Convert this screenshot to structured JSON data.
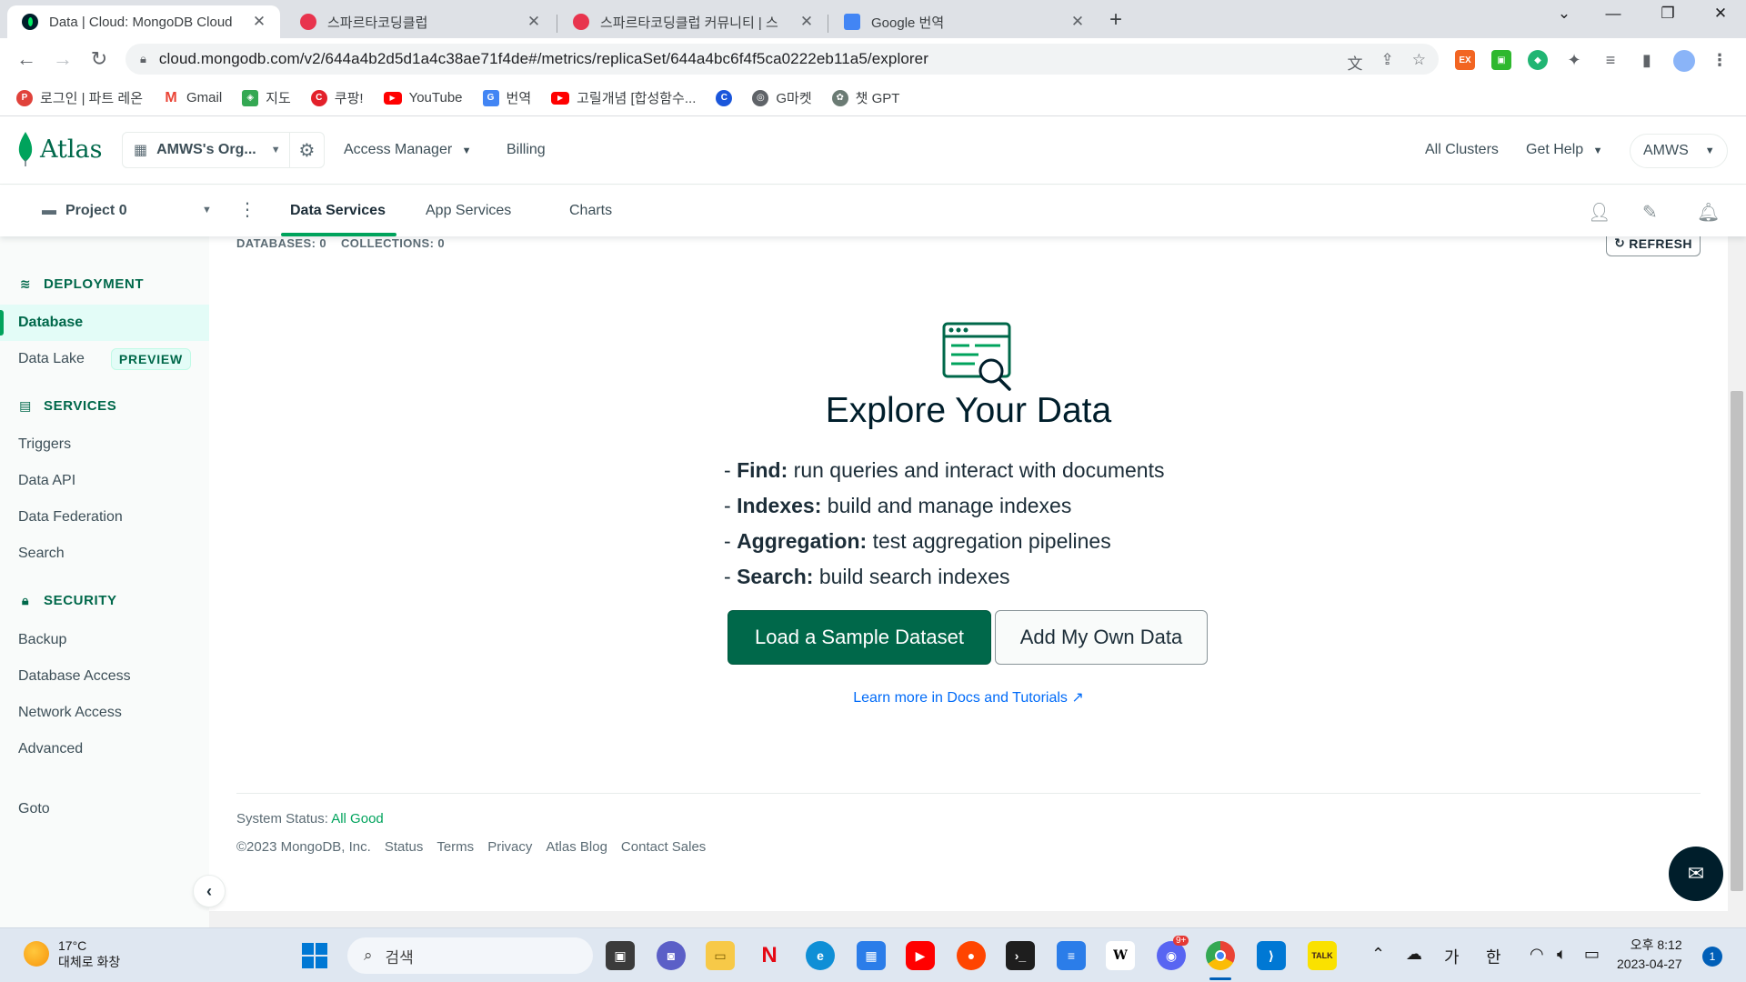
{
  "browser": {
    "tabs": [
      {
        "title": "Data | Cloud: MongoDB Cloud",
        "active": true
      },
      {
        "title": "스파르타코딩클럽",
        "active": false
      },
      {
        "title": "스파르타코딩클럽 커뮤니티 | 스",
        "active": false
      },
      {
        "title": "Google 번역",
        "active": false
      }
    ],
    "url": "cloud.mongodb.com/v2/644a4b2d5d1a4c38ae71f4de#/metrics/replicaSet/644a4bc6f4f5ca0222eb11a5/explorer",
    "bookmarks": [
      "로그인 | 파트 레온",
      "Gmail",
      "지도",
      "쿠팡!",
      "YouTube",
      "번역",
      "고릴개념 [합성함수...",
      "G마켓",
      "챗 GPT"
    ]
  },
  "atlas": {
    "logo": "Atlas",
    "org": "AMWS's Org...",
    "access_manager": "Access Manager",
    "billing": "Billing",
    "all_clusters": "All Clusters",
    "get_help": "Get Help",
    "user": "AMWS"
  },
  "project": {
    "name": "Project 0",
    "tabs": [
      "Data Services",
      "App Services",
      "Charts"
    ]
  },
  "sidebar": {
    "deployment": "DEPLOYMENT",
    "database": "Database",
    "data_lake": "Data Lake",
    "preview": "PREVIEW",
    "services": "SERVICES",
    "triggers": "Triggers",
    "data_api": "Data API",
    "data_federation": "Data Federation",
    "search": "Search",
    "security": "SECURITY",
    "backup": "Backup",
    "database_access": "Database Access",
    "network_access": "Network Access",
    "advanced": "Advanced",
    "goto": "Goto"
  },
  "main": {
    "databases_label": "DATABASES:",
    "databases_count": "0",
    "collections_label": "COLLECTIONS:",
    "collections_count": "0",
    "refresh": "REFRESH",
    "title": "Explore Your Data",
    "features": [
      {
        "key": "Find:",
        "text": "run queries and interact with documents"
      },
      {
        "key": "Indexes:",
        "text": "build and manage indexes"
      },
      {
        "key": "Aggregation:",
        "text": "test aggregation pipelines"
      },
      {
        "key": "Search:",
        "text": "build search indexes"
      }
    ],
    "load_sample": "Load a Sample Dataset",
    "add_own": "Add My Own Data",
    "learn_more": "Learn more in Docs and Tutorials"
  },
  "footer": {
    "system_status_label": "System Status:",
    "system_status_value": "All Good",
    "copyright": "©2023 MongoDB, Inc.",
    "links": [
      "Status",
      "Terms",
      "Privacy",
      "Atlas Blog",
      "Contact Sales"
    ]
  },
  "taskbar": {
    "temp": "17°C",
    "weather": "대체로 화창",
    "search": "검색",
    "ime1": "가",
    "ime2": "한",
    "time": "오후 8:12",
    "date": "2023-04-27",
    "notifications": "1",
    "discord_badge": "9+"
  },
  "colors": {
    "brand_green": "#00684a",
    "accent_green": "#00a35c",
    "link_blue": "#016bf8"
  }
}
